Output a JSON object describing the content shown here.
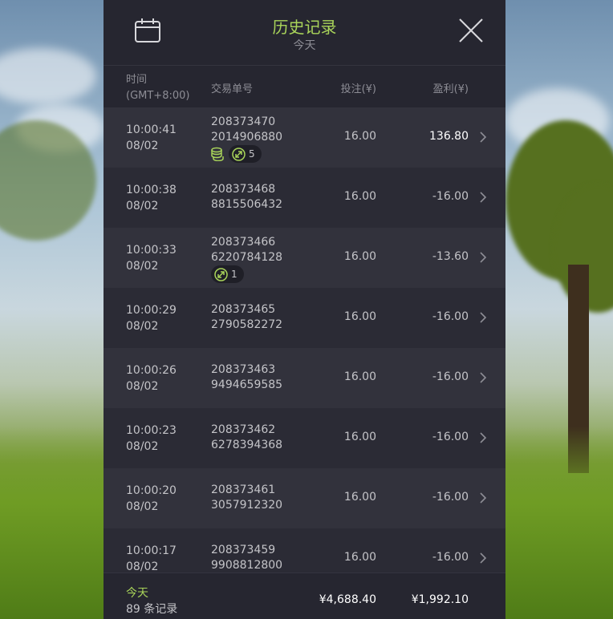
{
  "header": {
    "title": "历史记录",
    "subtitle": "今天",
    "calendar_icon": "calendar-icon",
    "close_icon": "close-icon"
  },
  "columns": {
    "time_line1": "时间",
    "time_line2": "(GMT+8:00)",
    "order": "交易单号",
    "bet": "投注(¥)",
    "profit": "盈利(¥)"
  },
  "rows": [
    {
      "time": "10:00:41",
      "date": "08/02",
      "order1": "208373470",
      "order2": "2014906880",
      "bet": "16.00",
      "profit": "136.80",
      "win": true,
      "coins": true,
      "count": "5"
    },
    {
      "time": "10:00:38",
      "date": "08/02",
      "order1": "208373468",
      "order2": "8815506432",
      "bet": "16.00",
      "profit": "-16.00",
      "win": false,
      "coins": false,
      "count": ""
    },
    {
      "time": "10:00:33",
      "date": "08/02",
      "order1": "208373466",
      "order2": "6220784128",
      "bet": "16.00",
      "profit": "-13.60",
      "win": false,
      "coins": false,
      "count": "1"
    },
    {
      "time": "10:00:29",
      "date": "08/02",
      "order1": "208373465",
      "order2": "2790582272",
      "bet": "16.00",
      "profit": "-16.00",
      "win": false,
      "coins": false,
      "count": ""
    },
    {
      "time": "10:00:26",
      "date": "08/02",
      "order1": "208373463",
      "order2": "9494659585",
      "bet": "16.00",
      "profit": "-16.00",
      "win": false,
      "coins": false,
      "count": ""
    },
    {
      "time": "10:00:23",
      "date": "08/02",
      "order1": "208373462",
      "order2": "6278394368",
      "bet": "16.00",
      "profit": "-16.00",
      "win": false,
      "coins": false,
      "count": ""
    },
    {
      "time": "10:00:20",
      "date": "08/02",
      "order1": "208373461",
      "order2": "3057912320",
      "bet": "16.00",
      "profit": "-16.00",
      "win": false,
      "coins": false,
      "count": ""
    },
    {
      "time": "10:00:17",
      "date": "08/02",
      "order1": "208373459",
      "order2": "9908812800",
      "bet": "16.00",
      "profit": "-16.00",
      "win": false,
      "coins": false,
      "count": ""
    }
  ],
  "footer": {
    "label": "今天",
    "count_text": "89 条记录",
    "total_bet": "¥4,688.40",
    "total_profit": "¥1,992.10"
  },
  "colors": {
    "accent": "#a9d45a",
    "panel_bg": "#262630",
    "row_odd": "#32323c",
    "row_even": "#2b2b35"
  }
}
